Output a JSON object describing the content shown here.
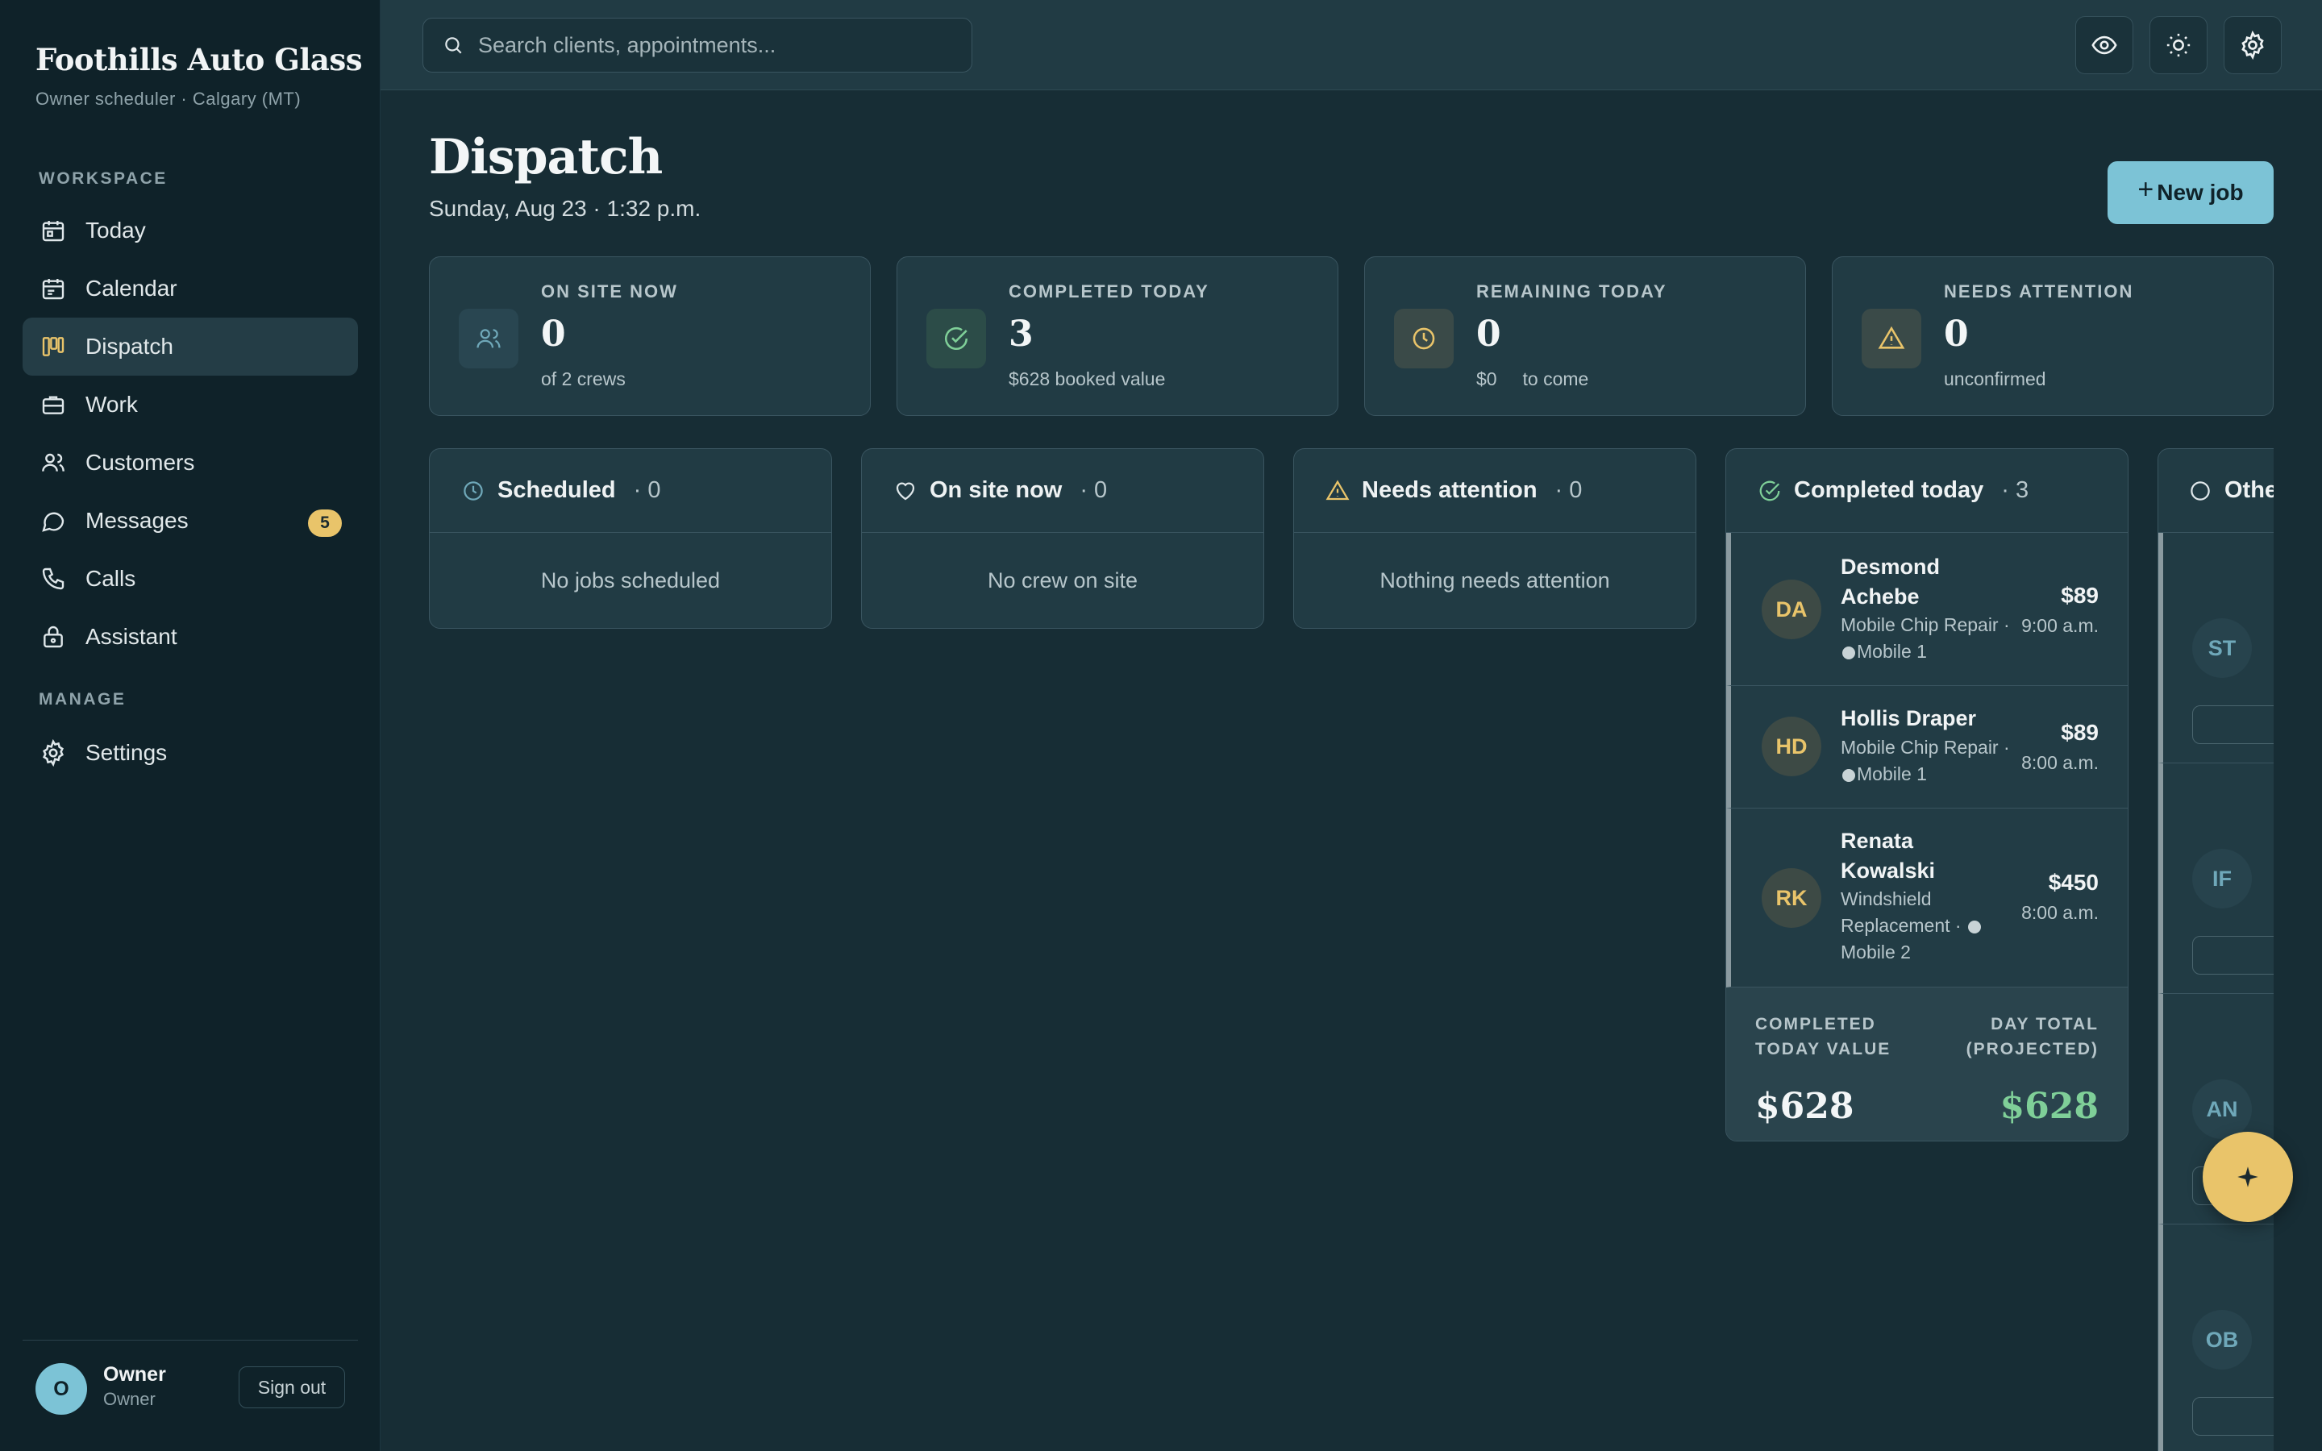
{
  "brand": {
    "title": "Foothills Auto Glass",
    "subtitle": "Owner scheduler · Calgary (MT)"
  },
  "sidebar": {
    "workspace_label": "WORKSPACE",
    "manage_label": "MANAGE",
    "items": [
      {
        "label": "Today",
        "icon": "calendar-day-icon"
      },
      {
        "label": "Calendar",
        "icon": "calendar-icon"
      },
      {
        "label": "Dispatch",
        "icon": "kanban-icon",
        "active": true
      },
      {
        "label": "Work",
        "icon": "briefcase-icon"
      },
      {
        "label": "Customers",
        "icon": "users-icon"
      },
      {
        "label": "Messages",
        "icon": "chat-icon",
        "badge": "5"
      },
      {
        "label": "Calls",
        "icon": "phone-icon"
      },
      {
        "label": "Assistant",
        "icon": "bot-icon"
      }
    ],
    "manage_items": [
      {
        "label": "Settings",
        "icon": "gear-icon"
      }
    ],
    "user": {
      "initial": "O",
      "name": "Owner",
      "role": "Owner",
      "signout": "Sign out"
    }
  },
  "search": {
    "placeholder": "Search clients, appointments..."
  },
  "header": {
    "title": "Dispatch",
    "date": "Sunday, Aug 23 · 1:32 p.m.",
    "new_job": "New job"
  },
  "stats": [
    {
      "label": "ON SITE NOW",
      "value": "0",
      "sub": "of 2 crews",
      "icon": "users-icon",
      "color": "#6fa8b9"
    },
    {
      "label": "COMPLETED TODAY",
      "value": "3",
      "sub": "$628 booked value",
      "icon": "check-circle-icon",
      "color": "#7fcf98"
    },
    {
      "label": "REMAINING TODAY",
      "value": "0",
      "sub": "$0     to come",
      "icon": "clock-icon",
      "color": "#e9c46a"
    },
    {
      "label": "NEEDS ATTENTION",
      "value": "0",
      "sub": "unconfirmed",
      "icon": "alert-triangle-icon",
      "color": "#e9c46a"
    }
  ],
  "columns": {
    "scheduled": {
      "title": "Scheduled",
      "count": "· 0",
      "empty": "No jobs scheduled"
    },
    "on_site": {
      "title": "On site now",
      "count": "· 0",
      "empty": "No crew on site"
    },
    "attention": {
      "title": "Needs attention",
      "count": "· 0",
      "empty": "Nothing needs attention"
    },
    "completed": {
      "title": "Completed today",
      "count": "· 3",
      "jobs": [
        {
          "initials": "DA",
          "name": "Desmond Achebe",
          "service": "Mobile Chip Repair ·",
          "crew": "Mobile 1",
          "price": "$89",
          "time": "9:00 a.m."
        },
        {
          "initials": "HD",
          "name": "Hollis Draper",
          "service": "Mobile Chip Repair ·",
          "crew": "Mobile 1",
          "price": "$89",
          "time": "8:00 a.m."
        },
        {
          "initials": "RK",
          "name": "Renata Kowalski",
          "service": "Windshield Replacement ·",
          "crew": "Mobile 2",
          "price": "$450",
          "time": "8:00 a.m."
        }
      ],
      "footer": {
        "left_label": "COMPLETED TODAY VALUE",
        "right_label": "DAY TOTAL (PROJECTED)",
        "left_value": "$628",
        "right_value": "$628"
      }
    },
    "other": {
      "title": "Othe",
      "rows": [
        "ST",
        "IF",
        "AN",
        "OB"
      ]
    }
  },
  "colors": {
    "accent": "#7cc3d6",
    "gold": "#e9c46a",
    "green": "#7fcf98"
  }
}
